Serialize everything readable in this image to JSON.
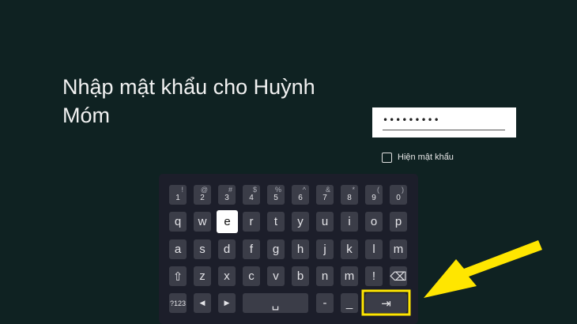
{
  "dialog": {
    "title": "Nhập mật khẩu cho Huỳnh Móm",
    "password_value": "•••••••••",
    "show_password_label": "Hiện mật khẩu",
    "show_password_checked": false
  },
  "keyboard": {
    "number_row": [
      {
        "main": "1",
        "sup": "!"
      },
      {
        "main": "2",
        "sup": "@"
      },
      {
        "main": "3",
        "sup": "#"
      },
      {
        "main": "4",
        "sup": "$"
      },
      {
        "main": "5",
        "sup": "%"
      },
      {
        "main": "6",
        "sup": "^"
      },
      {
        "main": "7",
        "sup": "&"
      },
      {
        "main": "8",
        "sup": "*"
      },
      {
        "main": "9",
        "sup": "("
      },
      {
        "main": "0",
        "sup": ")"
      }
    ],
    "row1": [
      "q",
      "w",
      "e",
      "r",
      "t",
      "y",
      "u",
      "i",
      "o",
      "p"
    ],
    "row2": [
      "a",
      "s",
      "d",
      "f",
      "g",
      "h",
      "j",
      "k",
      "l",
      "m"
    ],
    "row3": [
      "z",
      "x",
      "c",
      "v",
      "b",
      "n",
      "m",
      "!"
    ],
    "active_key": "e",
    "symbols_label": "?123",
    "left_arrow": "◀",
    "right_arrow": "▶",
    "space_symbol": "␣",
    "dash": "-",
    "underscore": "_",
    "shift_icon": "⇧",
    "backspace_icon": "⌫",
    "tab_icon": "⇥"
  },
  "highlight_color": "#ffe600"
}
